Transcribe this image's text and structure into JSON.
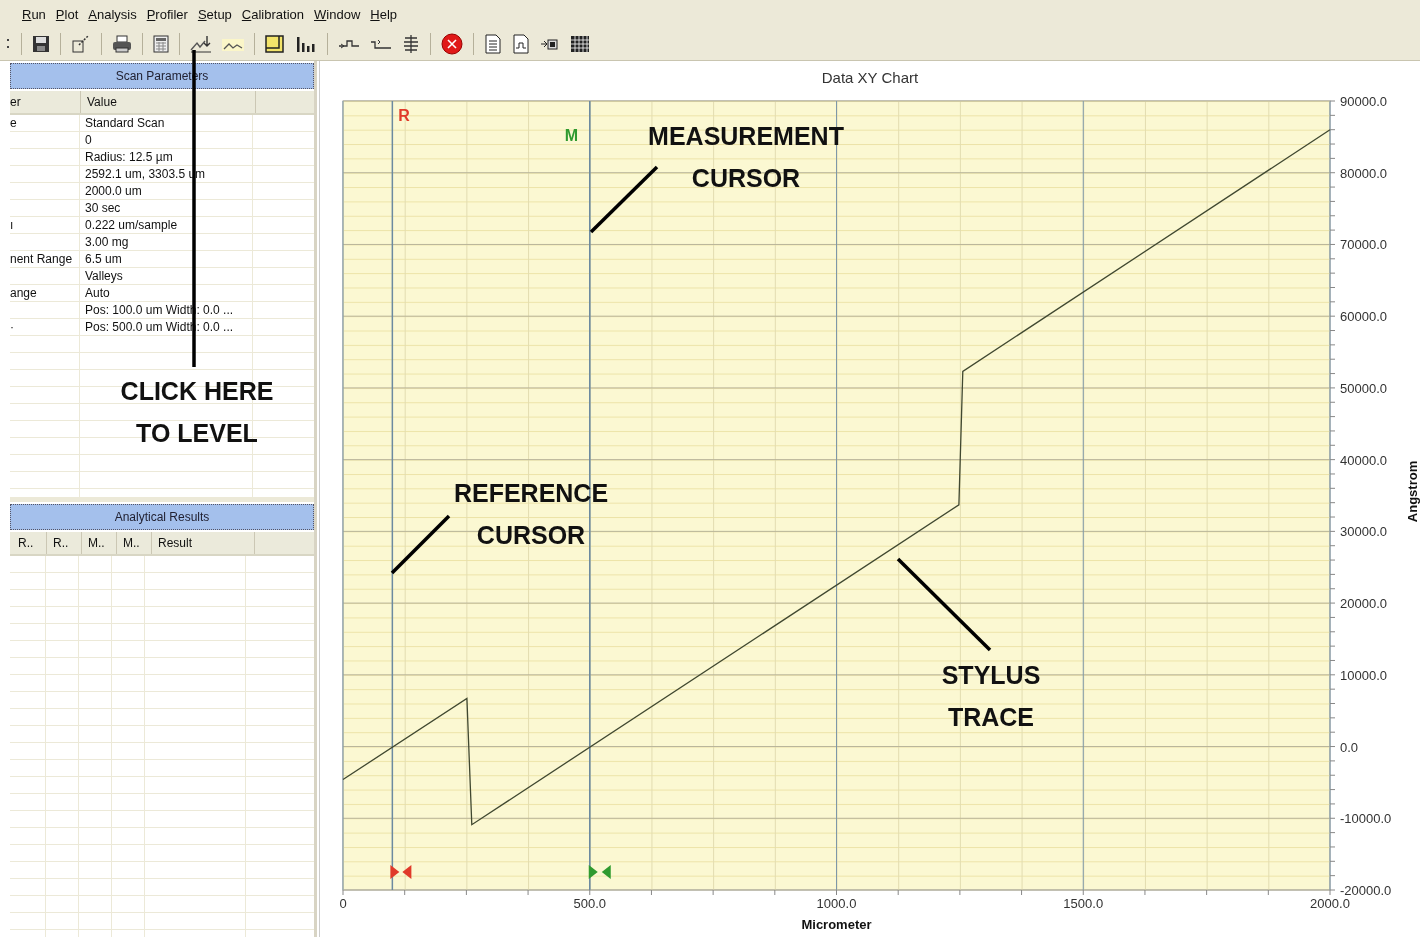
{
  "menu": [
    "Run",
    "Plot",
    "Analysis",
    "Profiler",
    "Setup",
    "Calibration",
    "Window",
    "Help"
  ],
  "scan_parameters": {
    "title": "Scan Parameters",
    "columns": [
      "er",
      "Value"
    ],
    "rows": [
      {
        "name": "e",
        "value": "Standard Scan"
      },
      {
        "value": "0"
      },
      {
        "value": "Radius: 12.5 µm"
      },
      {
        "value": "2592.1 um, 3303.5 um"
      },
      {
        "value": "2000.0 um"
      },
      {
        "value": "30 sec"
      },
      {
        "name": "ı",
        "value": "0.222 um/sample"
      },
      {
        "value": "3.00 mg"
      },
      {
        "name": "nent Range",
        "value": "6.5 um"
      },
      {
        "value": "Valleys"
      },
      {
        "name": "ange",
        "value": "Auto"
      },
      {
        "value": "Pos: 100.0 um Width: 0.0 ..."
      },
      {
        "name": "·",
        "value": "Pos: 500.0 um Width: 0.0 ..."
      }
    ]
  },
  "analytical_results": {
    "title": "Analytical Results",
    "columns": [
      "R..",
      "R..",
      "M..",
      "M..",
      "Result"
    ]
  },
  "chart": {
    "title": "Data XY Chart",
    "chart_data": {
      "type": "line",
      "xlabel": "Micrometer",
      "ylabel": "Angstrom",
      "x": [
        0,
        251,
        261,
        1248,
        1256,
        2000
      ],
      "series": [
        {
          "color": "#404830",
          "values": [
            -4600,
            6700,
            -10900,
            33700,
            52300,
            86000
          ]
        }
      ],
      "grid": true,
      "xlim": [
        0,
        2000
      ],
      "ylim": [
        -20000,
        90000
      ],
      "xticks": [
        0,
        {
          "value": 500,
          "label": "500.0"
        },
        {
          "value": 1000,
          "label": "1000.0"
        },
        {
          "value": 1500,
          "label": "1500.0"
        },
        {
          "value": 2000,
          "label": "2000.0"
        }
      ],
      "yticks": [
        {
          "value": 90000,
          "label": "90000.0"
        },
        {
          "value": 80000,
          "label": "80000.0"
        },
        {
          "value": 70000,
          "label": "70000.0"
        },
        {
          "value": 60000,
          "label": "60000.0"
        },
        {
          "value": 50000,
          "label": "50000.0"
        },
        {
          "value": 40000,
          "label": "40000.0"
        },
        {
          "value": 30000,
          "label": "30000.0"
        },
        {
          "value": 20000,
          "label": "20000.0"
        },
        {
          "value": 10000,
          "label": "10000.0"
        },
        {
          "value": 0,
          "label": "0.0"
        },
        {
          "value": -10000,
          "label": "-10000.0"
        },
        {
          "value": -20000,
          "label": "-20000.0"
        }
      ],
      "ref_lines": [
        {
          "axis": "x",
          "value": 100
        },
        {
          "axis": "x",
          "value": 500
        }
      ]
    },
    "cursors": [
      {
        "label": "R",
        "color": "#e03a2a"
      },
      {
        "label": "M",
        "color": "#2f9a2f"
      }
    ]
  },
  "callouts": [
    {
      "lines": [
        "CLICK HERE",
        "TO LEVEL"
      ]
    },
    {
      "lines": [
        "MEASUREMENT",
        "CURSOR"
      ]
    },
    {
      "lines": [
        "REFERENCE",
        "CURSOR"
      ]
    },
    {
      "lines": [
        "STYLUS",
        "TRACE"
      ]
    }
  ]
}
